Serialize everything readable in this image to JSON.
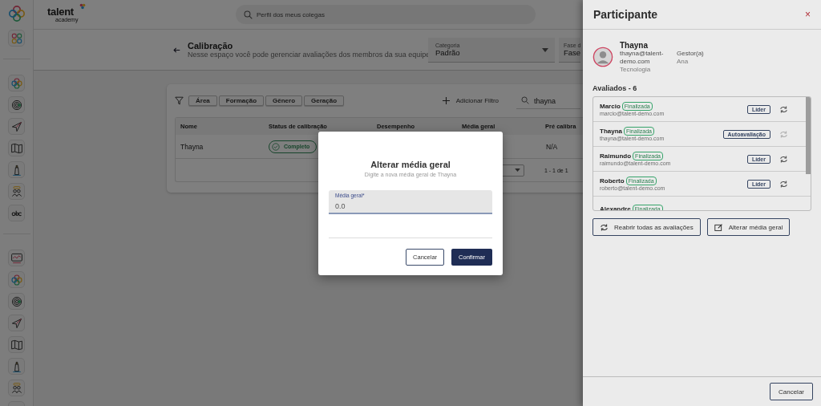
{
  "topbar": {
    "logo": "talent",
    "logo_sub": "academy",
    "search": {
      "placeholder": "Perfil dos meus colegas"
    }
  },
  "header": {
    "title": "Calibração",
    "subtitle": "Nesse espaço você pode gerenciar avaliações dos membros da sua equipe",
    "selects": [
      {
        "label": "Categoria",
        "value": "Padrão"
      },
      {
        "label": "Fase d",
        "value": "Fase"
      }
    ]
  },
  "filters": {
    "chips": [
      "Área",
      "Formação",
      "Gênero",
      "Geração"
    ],
    "add_filter": "Adicionar Filtro",
    "search_value": "thayna"
  },
  "table": {
    "columns": [
      "Nome",
      "Status de calibração",
      "Desempenho",
      "Média geral",
      "Pré calibra"
    ],
    "rows": [
      {
        "name": "Thayna",
        "status": "Completo",
        "pre": "N/A"
      }
    ],
    "pagination": "1 - 1 de 1"
  },
  "drawer": {
    "title": "Participante",
    "close": "×",
    "person": {
      "name": "Thayna",
      "email": "thayna@talent-demo.com",
      "area": "Tecnologia",
      "manager_label": "Gestor(a)",
      "manager": "Ana"
    },
    "evaluated_title": "Avaliados - 6",
    "evaluated": [
      {
        "name": "Marcio",
        "status": "Finalizada",
        "email": "marcio@talent-demo.com",
        "role": "Líder",
        "reopen_disabled": false
      },
      {
        "name": "Thayna",
        "status": "Finalizada",
        "email": "thayna@talent-demo.com",
        "role": "Autoavaliação",
        "reopen_disabled": true
      },
      {
        "name": "Raimundo",
        "status": "Finalizada",
        "email": "raimundo@talent-demo.com",
        "role": "Líder",
        "reopen_disabled": false
      },
      {
        "name": "Roberto",
        "status": "Finalizada",
        "email": "roberto@talent-demo.com",
        "role": "Líder",
        "reopen_disabled": false
      },
      {
        "name": "Alexandre",
        "status": "Finalizada"
      }
    ],
    "actions": [
      "Reabrir todas as avaliações",
      "Alterar média geral"
    ],
    "cancel": "Cancelar"
  },
  "dialog": {
    "title": "Alterar média geral",
    "subtitle": "Digite a nova média geral de Thayna",
    "field_label": "Média geral*",
    "field_value": "0.0",
    "buttons": [
      "Cancelar",
      "Confirmar"
    ]
  }
}
